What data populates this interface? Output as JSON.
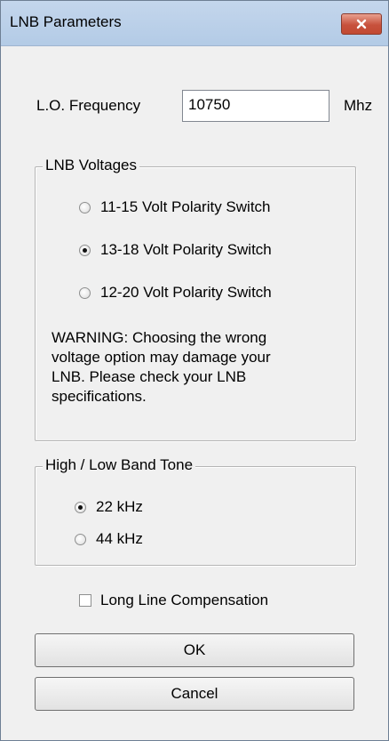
{
  "window": {
    "title": "LNB Parameters",
    "close_icon": "close-x-icon"
  },
  "lo_frequency": {
    "label": "L.O. Frequency",
    "value": "10750",
    "unit": "Mhz"
  },
  "voltages": {
    "group_title": "LNB Voltages",
    "options": [
      {
        "label": "11-15 Volt Polarity Switch",
        "selected": false
      },
      {
        "label": "13-18 Volt Polarity Switch",
        "selected": true
      },
      {
        "label": "12-20 Volt Polarity Switch",
        "selected": false
      }
    ],
    "warning": "WARNING: Choosing the wrong\nvoltage option may damage your\nLNB.  Please check your LNB\nspecifications."
  },
  "tone": {
    "group_title": "High / Low Band Tone",
    "options": [
      {
        "label": "22 kHz",
        "selected": true
      },
      {
        "label": "44 kHz",
        "selected": false
      }
    ]
  },
  "long_line": {
    "label": "Long Line Compensation",
    "checked": false
  },
  "buttons": {
    "ok": "OK",
    "cancel": "Cancel"
  },
  "colors": {
    "titlebar": "#b9cfe8",
    "close_button": "#c7513c",
    "dialog_bg": "#f0f0f0"
  }
}
